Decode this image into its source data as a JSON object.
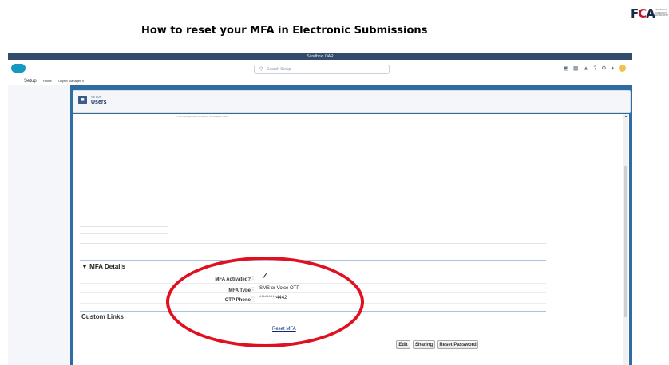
{
  "document": {
    "title": "How to reset your MFA in Electronic Submissions",
    "logo_text": "FCA",
    "logo_side_text": [
      "FINANCIAL",
      "CONDUCT",
      "AUTHORITY"
    ]
  },
  "browser": {
    "org_banner": "Sandbox: OAR"
  },
  "header": {
    "search_placeholder": "Search Setup",
    "icons": [
      "add-icon",
      "favorites-icon",
      "trailhead-icon",
      "help-icon",
      "gear-icon",
      "bell-icon",
      "avatar-icon"
    ]
  },
  "nav": {
    "app_name": "Setup",
    "tabs": [
      "Home",
      "Object Manager ∨"
    ]
  },
  "page_header": {
    "eyebrow": "SETUP",
    "title": "Users"
  },
  "faint_text": "This message uses formatting, as detailed below.",
  "mfa": {
    "section_title": "MFA Details",
    "rows": [
      {
        "label": "MFA Activated?",
        "value": "✓"
      },
      {
        "label": "MFA Type",
        "value": "SMS or Voice OTP"
      },
      {
        "label": "OTP Phone",
        "value": "*********4442"
      }
    ]
  },
  "custom_links": {
    "section_title": "Custom Links",
    "link": "Reset MFA"
  },
  "buttons": {
    "edit": "Edit",
    "sharing": "Sharing",
    "reset_password": "Reset Password"
  },
  "colors": {
    "annotation": "#e01020",
    "header_bar": "#344c6b",
    "page_bg": "#2e6ca4"
  }
}
